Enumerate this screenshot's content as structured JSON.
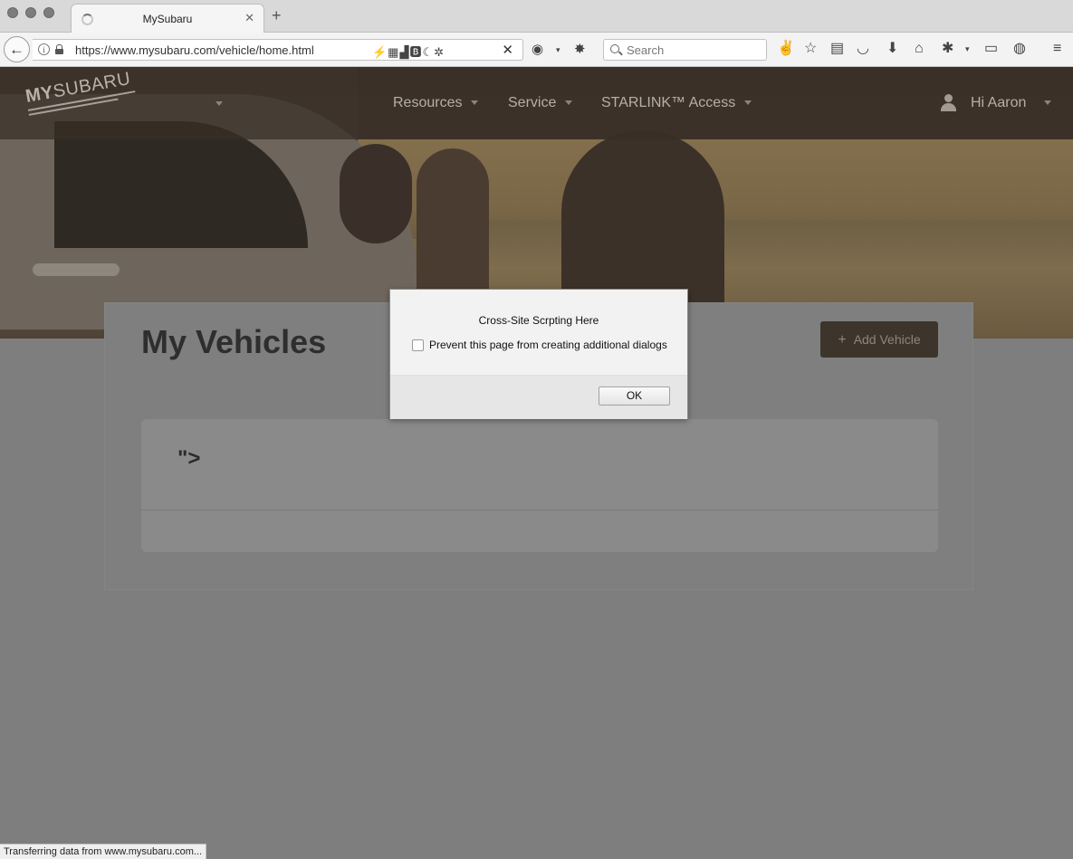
{
  "browser": {
    "tab_title": "MySubaru",
    "tab_close": "✕",
    "new_tab": "+",
    "back": "←",
    "url": "https://www.mysubaru.com/vehicle/home.html",
    "url_icons": "⚡▦▟🅱☾✲",
    "stop": "✕",
    "search_placeholder": "Search",
    "status_text": "Transferring data from www.mysubaru.com..."
  },
  "site": {
    "logo_bold": "MY",
    "logo_thin": "SUBARU",
    "nav": [
      {
        "label": "Resources"
      },
      {
        "label": "Service"
      },
      {
        "label": "STARLINK™ Access"
      }
    ],
    "user_greeting": "Hi Aaron"
  },
  "main": {
    "title": "My Vehicles",
    "add_button_icon": "+",
    "add_button_label": "Add Vehicle",
    "vehicle_name": "\">"
  },
  "dialog": {
    "message": "Cross-Site Scrpting Here",
    "checkbox_label": "Prevent this page from creating additional dialogs",
    "ok_label": "OK"
  },
  "colors": {
    "overlay_gray": "#7e7e7e",
    "header_brown": "#382e26",
    "button_brown": "#3d342c"
  }
}
